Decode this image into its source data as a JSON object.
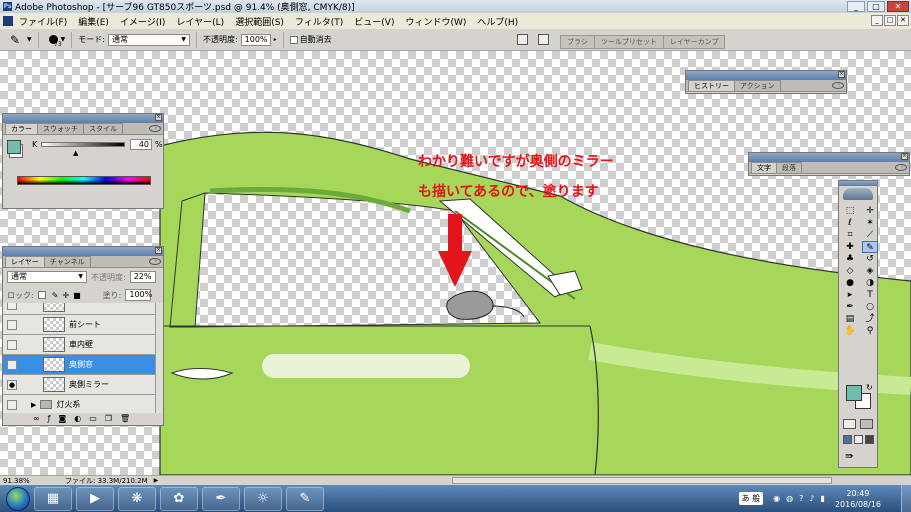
{
  "window": {
    "title": "Adobe Photoshop - [サーブ96 GT850スポーツ.psd @ 91.4% (奥側窓, CMYK/8)]",
    "minimize": "_",
    "maximize": "□",
    "close": "✕"
  },
  "menu": {
    "items": [
      "ファイル(F)",
      "編集(E)",
      "イメージ(I)",
      "レイヤー(L)",
      "選択範囲(S)",
      "フィルタ(T)",
      "ビュー(V)",
      "ウィンドウ(W)",
      "ヘルプ(H)"
    ]
  },
  "options": {
    "brush_size": "73",
    "mode_label": "モード:",
    "mode_value": "通常",
    "opacity_label": "不透明度:",
    "opacity_value": "100%",
    "auto_erase": "自動消去",
    "well_tabs": [
      "ブラシ",
      "ツールプリセット",
      "レイヤーカンプ"
    ]
  },
  "annotation": {
    "line1": "わかり難いですが奥側のミラー",
    "line2": "も描いてあるので、塗ります"
  },
  "colors": {
    "car_green": "#a6d65a",
    "car_green_light": "#c8ea94",
    "annotation_red": "#e4141b",
    "foreground": "#6fbeb0",
    "selected_layer": "#3a8ee6"
  },
  "color_panel": {
    "tabs": [
      "カラー",
      "スウォッチ",
      "スタイル"
    ],
    "channel": "K",
    "value": "40",
    "unit": "%"
  },
  "history_panel": {
    "tabs": [
      "ヒストリー",
      "アクション"
    ]
  },
  "text_panel": {
    "tabs": [
      "文字",
      "段落"
    ]
  },
  "layers_panel": {
    "tabs": [
      "レイヤー",
      "チャンネル"
    ],
    "blend": "通常",
    "opacity_label": "不透明度:",
    "opacity_value": "22%",
    "lock_label": "ロック:",
    "fill_label": "塗り:",
    "fill_value": "100%",
    "layers": [
      {
        "name": "前シート",
        "visible": false,
        "selected": false
      },
      {
        "name": "車内壁",
        "visible": false,
        "selected": false
      },
      {
        "name": "奥側窓",
        "visible": false,
        "selected": true
      },
      {
        "name": "奥側ミラー",
        "visible": true,
        "selected": false
      },
      {
        "name": "灯火系",
        "visible": false,
        "selected": false,
        "group": true
      }
    ]
  },
  "status": {
    "zoom": "91.38%",
    "file": "ファイル: 33.3M/210.2M"
  },
  "taskbar": {
    "time": "20:49",
    "date": "2016/08/16",
    "ime": "あ 般"
  }
}
